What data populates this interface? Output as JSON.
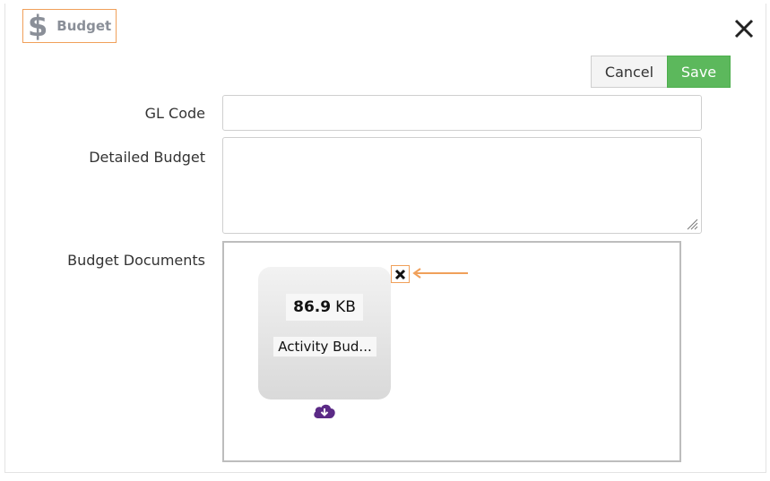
{
  "dialog": {
    "title": "Budget",
    "title_icon": "dollar-icon",
    "close_icon": "close-icon"
  },
  "toolbar": {
    "cancel_label": "Cancel",
    "save_label": "Save",
    "save_color": "#5cb85c"
  },
  "form": {
    "gl_code_label": "GL Code",
    "gl_code_value": "",
    "detailed_budget_label": "Detailed Budget",
    "detailed_budget_value": "",
    "budget_documents_label": "Budget Documents"
  },
  "documents": [
    {
      "size_value": "86.9",
      "size_unit": "KB",
      "name": "Activity Bud...",
      "remove_icon": "remove-x-icon",
      "download_icon": "cloud-download-icon"
    }
  ],
  "colors": {
    "highlight_orange": "#f0a05a",
    "download_purple": "#5b2a86"
  }
}
